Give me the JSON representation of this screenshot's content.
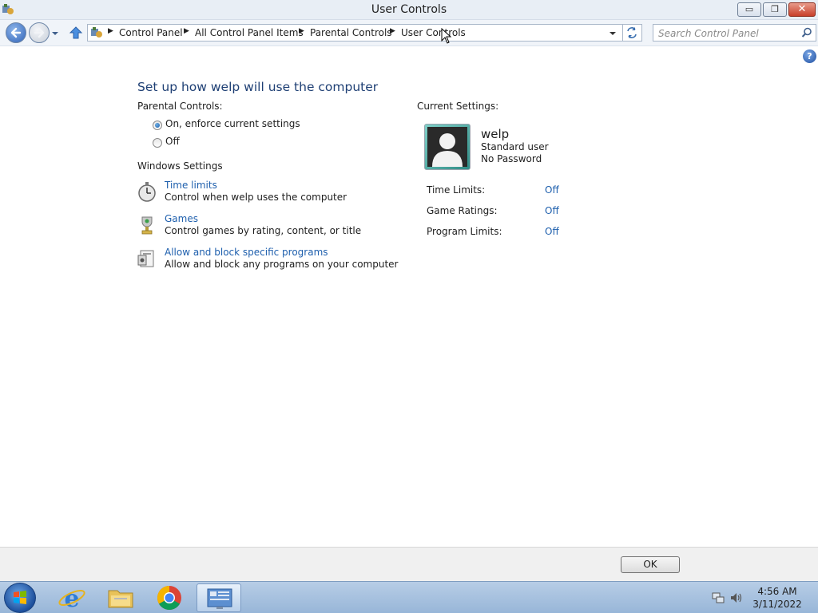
{
  "window": {
    "title": "User Controls"
  },
  "titlebar_buttons": {
    "minimize": "▭",
    "maximize": "❐",
    "close": "✕"
  },
  "address": {
    "crumbs": [
      "Control Panel",
      "All Control Panel Items",
      "Parental Controls",
      "User Controls"
    ]
  },
  "search": {
    "placeholder": "Search Control Panel"
  },
  "help": {
    "label": "?"
  },
  "main": {
    "heading": "Set up how welp will use the computer",
    "parental_controls_label": "Parental Controls:",
    "options": [
      {
        "label": "On, enforce current settings",
        "checked": true
      },
      {
        "label": "Off",
        "checked": false
      }
    ],
    "windows_settings_label": "Windows Settings",
    "settings": [
      {
        "icon": "stopwatch-icon",
        "link": "Time limits",
        "desc": "Control when welp uses the computer"
      },
      {
        "icon": "trophy-icon",
        "link": "Games",
        "desc": "Control games by rating, content, or title"
      },
      {
        "icon": "programs-icon",
        "link": "Allow and block specific programs",
        "desc": "Allow and block any programs on your computer"
      }
    ]
  },
  "current": {
    "label": "Current Settings:",
    "username": "welp",
    "account_type": "Standard user",
    "password": "No Password",
    "rows": [
      {
        "label": "Time Limits:",
        "value": "Off"
      },
      {
        "label": "Game Ratings:",
        "value": "Off"
      },
      {
        "label": "Program Limits:",
        "value": "Off"
      }
    ]
  },
  "footer": {
    "ok_label": "OK"
  },
  "taskbar": {
    "apps": [
      "internet-explorer-icon",
      "file-explorer-icon",
      "chrome-icon",
      "control-panel-icon"
    ],
    "time": "4:56 AM",
    "date": "3/11/2022"
  },
  "colors": {
    "link": "#1e5fad",
    "heading": "#1e3f74",
    "taskbar": "#a9c4e3"
  }
}
